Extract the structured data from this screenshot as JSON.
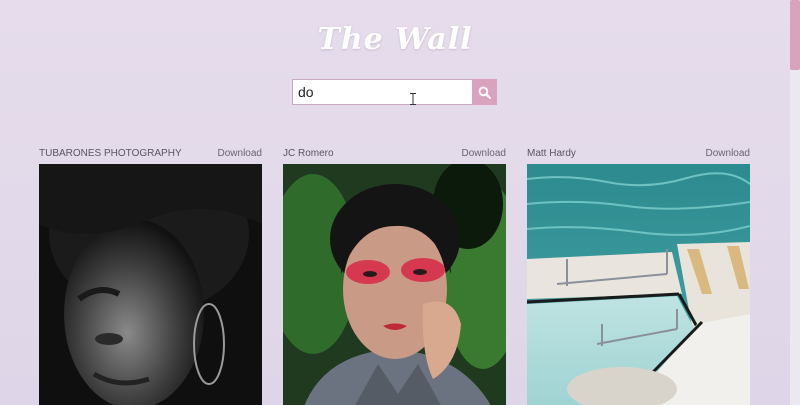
{
  "app": {
    "title": "The Wall"
  },
  "search": {
    "value": "do",
    "icon": "search-icon",
    "accent": "#d9a3bd"
  },
  "cards": [
    {
      "author": "TUBARONES PHOTOGRAPHY",
      "download_label": "Download",
      "image": "woman-portrait-black-and-white"
    },
    {
      "author": "JC Romero",
      "download_label": "Download",
      "image": "woman-portrait-red-eye-makeup"
    },
    {
      "author": "Matt Hardy",
      "download_label": "Download",
      "image": "ocean-pool-with-railings"
    }
  ]
}
